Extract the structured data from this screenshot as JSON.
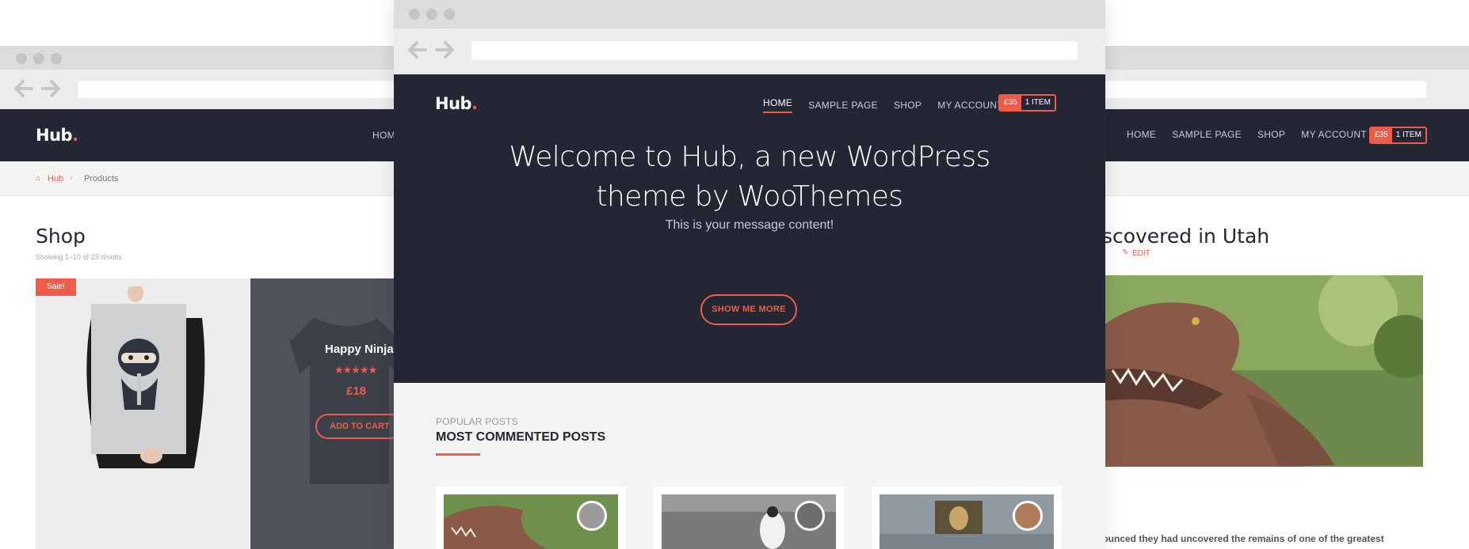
{
  "colors": {
    "dark": "#232734",
    "accent": "#ef5c4c",
    "light": "#f4f4f2"
  },
  "icons": [
    "back-arrow-icon",
    "forward-arrow-icon",
    "home-icon",
    "chevron-down-icon",
    "edit-icon",
    "star-icon"
  ],
  "left_window": {
    "logo": "Hub",
    "logo_dot": ".",
    "nav_partial": "HOM",
    "breadcrumb": {
      "home": "Hub",
      "separator": "›",
      "current": "Products"
    },
    "page_title": "Shop",
    "result_count": "Showing 1–10 of 23 results",
    "products": [
      {
        "badge": "Sale!"
      },
      {
        "name": "Happy Ninja",
        "rating": 5,
        "stars": "★★★★★",
        "price": "£18",
        "button": "ADD TO CART"
      }
    ]
  },
  "center_window": {
    "logo": "Hub",
    "logo_dot": ".",
    "nav": [
      "HOME",
      "SAMPLE PAGE",
      "SHOP",
      "MY ACCOUNT"
    ],
    "cart": {
      "price": "£35",
      "items": "1 ITEM"
    },
    "hero": {
      "title": "Welcome to Hub, a new WordPress theme by WooThemes",
      "message": "This is your message content!",
      "button": "SHOW ME MORE"
    },
    "section": {
      "kicker": "POPULAR POSTS",
      "title": "MOST COMMENTED POSTS"
    }
  },
  "right_window": {
    "nav": [
      "HOME",
      "SAMPLE PAGE",
      "SHOP",
      "MY ACCOUNT"
    ],
    "cart": {
      "price": "£35",
      "items": "1 ITEM"
    },
    "post_title": "iscovered in Utah",
    "meta_partial": "E",
    "edit_label": "EDIT",
    "excerpt": "nounced they had uncovered the remains of one of the greatest"
  }
}
